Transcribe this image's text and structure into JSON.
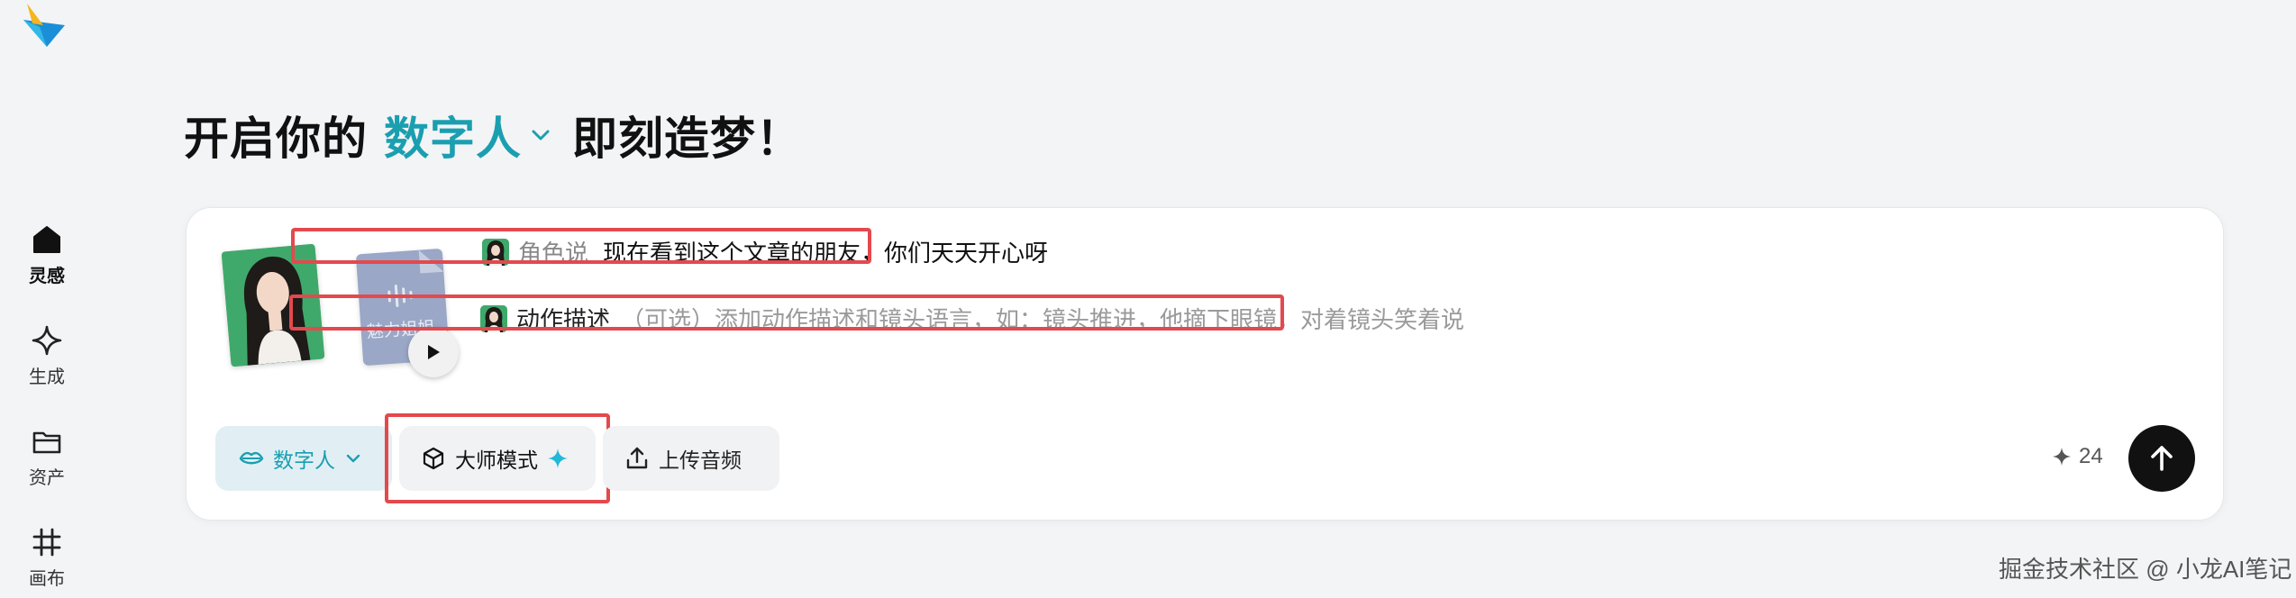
{
  "sidebar": {
    "items": [
      {
        "label": "灵感",
        "icon": "home-icon",
        "active": true
      },
      {
        "label": "生成",
        "icon": "sparkle-diamond-icon"
      },
      {
        "label": "资产",
        "icon": "folder-icon"
      },
      {
        "label": "画布",
        "icon": "canvas-grid-icon"
      }
    ]
  },
  "headline": {
    "prefix": "开启你的",
    "highlight": "数字人",
    "suffix": "即刻造梦！"
  },
  "composer": {
    "voice_name": "魅力姐姐",
    "speech_row": {
      "tag": "角色说",
      "value": "现在看到这个文章的朋友，你们天天开心呀"
    },
    "action_row": {
      "tag": "动作描述",
      "placeholder": "（可选）添加动作描述和镜头语言，如：镜头推进，他摘下眼镜，对着镜头笑着说"
    },
    "toolbar": {
      "digital_human_label": "数字人",
      "master_mode_label": "大师模式",
      "upload_audio_label": "上传音频",
      "credits": "24"
    }
  },
  "colors": {
    "accent": "#1a9fb0",
    "highlight_box": "#e3494d"
  },
  "watermark": "掘金技术社区 @ 小龙AI笔记"
}
